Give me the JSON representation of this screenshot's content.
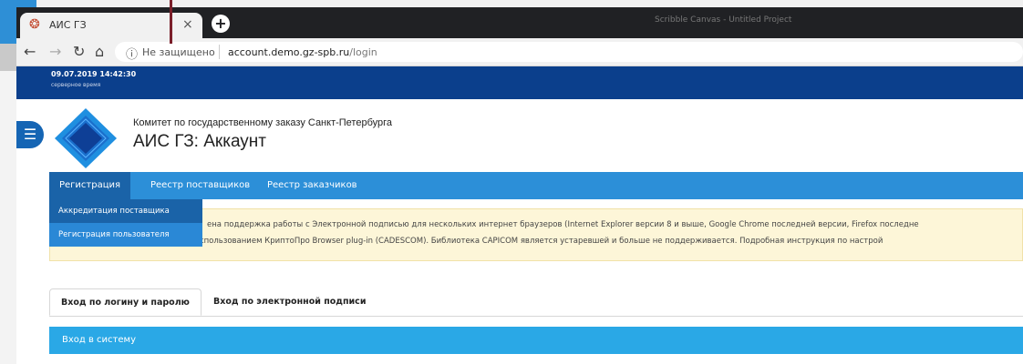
{
  "browser": {
    "tab": {
      "title": "АИС ГЗ",
      "close": "×",
      "favicon": "spinner-icon"
    },
    "new_tab": "+",
    "background_window_title": "Scribble Canvas - Untitled Project",
    "address": {
      "security_label": "Не защищено",
      "separator": "|",
      "host": "account.demo.gz-spb.ru",
      "path": "/login"
    }
  },
  "header": {
    "datetime": "09.07.2019 14:42:30",
    "datetime_caption": "серверное время",
    "org_name": "Комитет по государственному заказу Санкт-Петербурга",
    "app_title": "АИС ГЗ: Аккаунт"
  },
  "nav": {
    "items": [
      {
        "label": "Регистрация"
      },
      {
        "label": "Реестр поставщиков"
      },
      {
        "label": "Реестр заказчиков"
      }
    ],
    "dropdown": [
      {
        "label": "Аккредитация поставщика"
      },
      {
        "label": "Регистрация пользователя"
      }
    ]
  },
  "alert": {
    "line1": "ена поддержка работы с Электронной подписью для нескольких интернет браузеров (Internet Explorer версии 8 и выше, Google Chrome последней версии, Firefox последне",
    "line2": "подписью на вашем компьютере с использованием КриптоПро Browser plug-in (CADESCOM). Библиотека CAPICOM является устаревшей и больше не поддерживается. Подробная инструкция по настрой"
  },
  "login_tabs": [
    {
      "label": "Вход по логину и паролю"
    },
    {
      "label": "Вход по электронной подписи"
    }
  ],
  "panel": {
    "title": "Вход в систему"
  },
  "colors": {
    "topbar": "#0b3f8c",
    "nav": "#2c8fd8",
    "nav_active": "#1a63a8",
    "panel": "#2aa8e6",
    "alert_bg": "#fdf6d8"
  }
}
